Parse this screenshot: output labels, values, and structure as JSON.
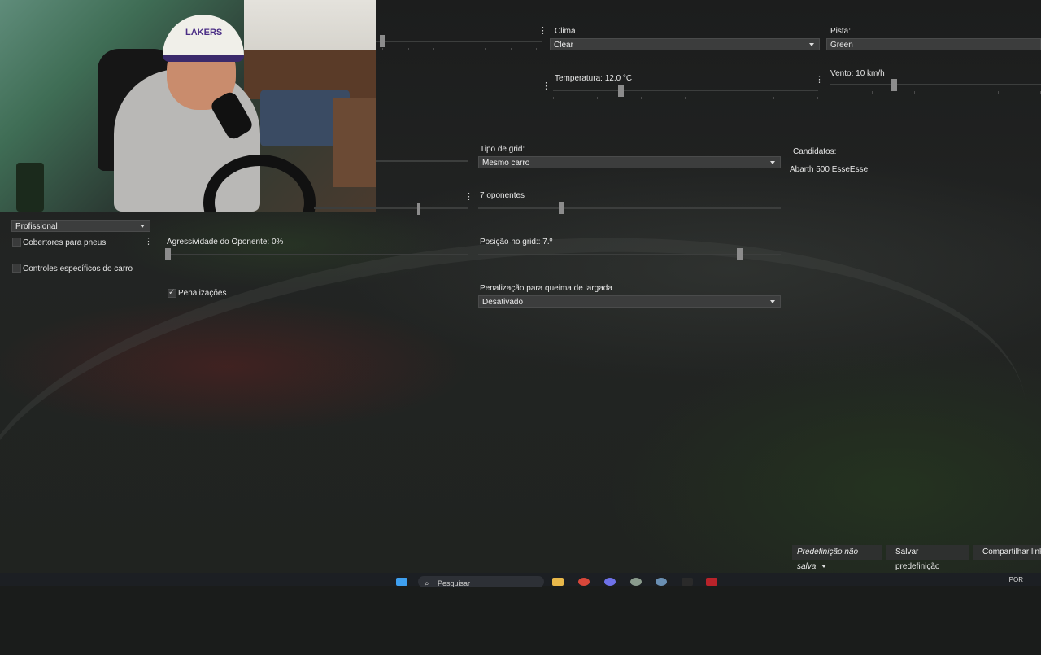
{
  "weather": {
    "label": "Clima",
    "value": "Clear",
    "temperature_label": "Temperatura: 12.0 °C",
    "temperature_level": 0.25
  },
  "track": {
    "label": "Pista:",
    "value": "Green",
    "wind_label": "Vento: 10 km/h",
    "wind_level": 0.3
  },
  "grid": {
    "type_label": "Tipo de grid:",
    "type_value": "Mesmo carro",
    "opponents_label": "7 oponentes",
    "opponents_level": 0.27,
    "position_label": "Posição no grid:: 7.º",
    "position_level": 0.87,
    "start_penalty_label": "Penalização para queima de largada",
    "start_penalty_value": "Desativado"
  },
  "candidates": {
    "label": "Candidatos:",
    "car": "Abarth 500 EsseEsse"
  },
  "assists": {
    "preset_value": "Profissional",
    "tyre_blankets_label": "Cobertores para pneus",
    "car_controls_label": "Controles específicos do carro"
  },
  "opponent": {
    "aggression_label": "Agressividade do Oponente: 0%",
    "aggression_level": 0.0
  },
  "penalties": {
    "label": "Penalizações",
    "checked": true
  },
  "footer": {
    "preset_status": "Predefinição não salva",
    "save_preset": "Salvar predefinição",
    "share_link": "Compartilhar link"
  },
  "taskbar": {
    "search_placeholder": "Pesquisar",
    "language": "POR"
  },
  "webcam": {
    "cap_logo": "LAKERS"
  }
}
